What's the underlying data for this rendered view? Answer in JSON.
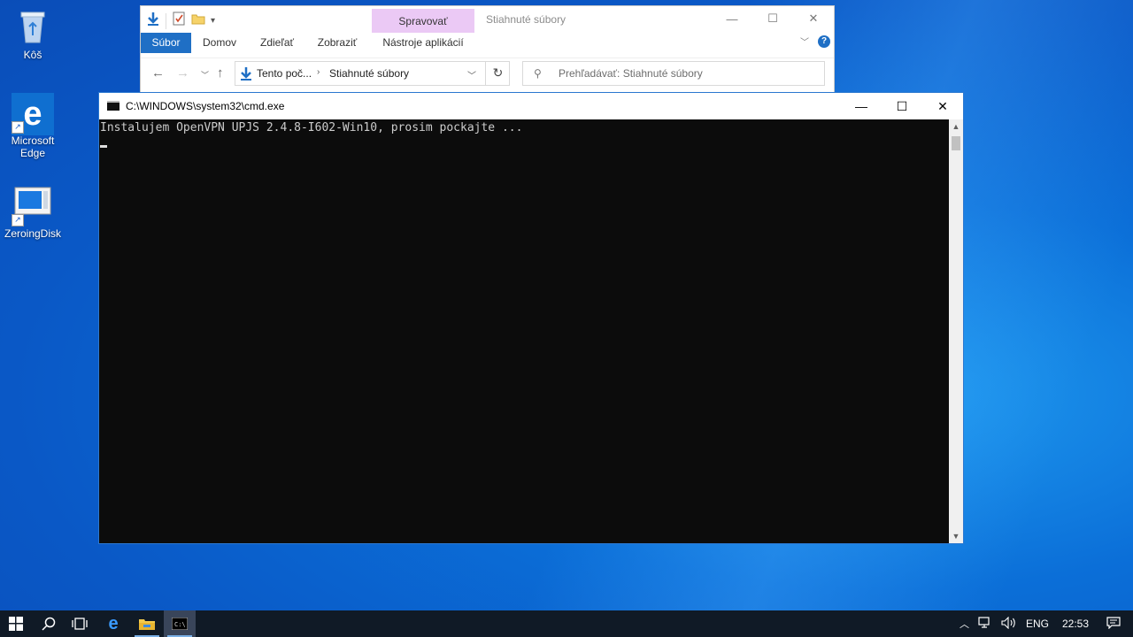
{
  "desktop": {
    "icons": [
      {
        "label": "Kôš"
      },
      {
        "label": "Microsoft Edge"
      },
      {
        "label": "ZeroingDisk"
      }
    ]
  },
  "explorer": {
    "title": "Stiahnuté súbory",
    "context_tab_group": "Spravovať",
    "ribbon_tabs": {
      "file": "Súbor",
      "home": "Domov",
      "share": "Zdieľať",
      "view": "Zobraziť",
      "app_tools": "Nástroje aplikácií"
    },
    "address": {
      "crumb1": "Tento poč...",
      "crumb2": "Stiahnuté súbory"
    },
    "search": {
      "placeholder": "Prehľadávať: Stiahnuté súbory"
    },
    "help": "?"
  },
  "cmd": {
    "title": "C:\\WINDOWS\\system32\\cmd.exe",
    "output_line": "Instalujem OpenVPN UPJS 2.4.8-I602-Win10, prosim pockajte ..."
  },
  "taskbar": {
    "tray": {
      "language": "ENG",
      "time": "22:53"
    }
  },
  "colors": {
    "accent": "#1f6fc5",
    "context_tab": "#ebc9f5",
    "console_bg": "#0c0c0c",
    "taskbar_bg": "#101a26"
  }
}
